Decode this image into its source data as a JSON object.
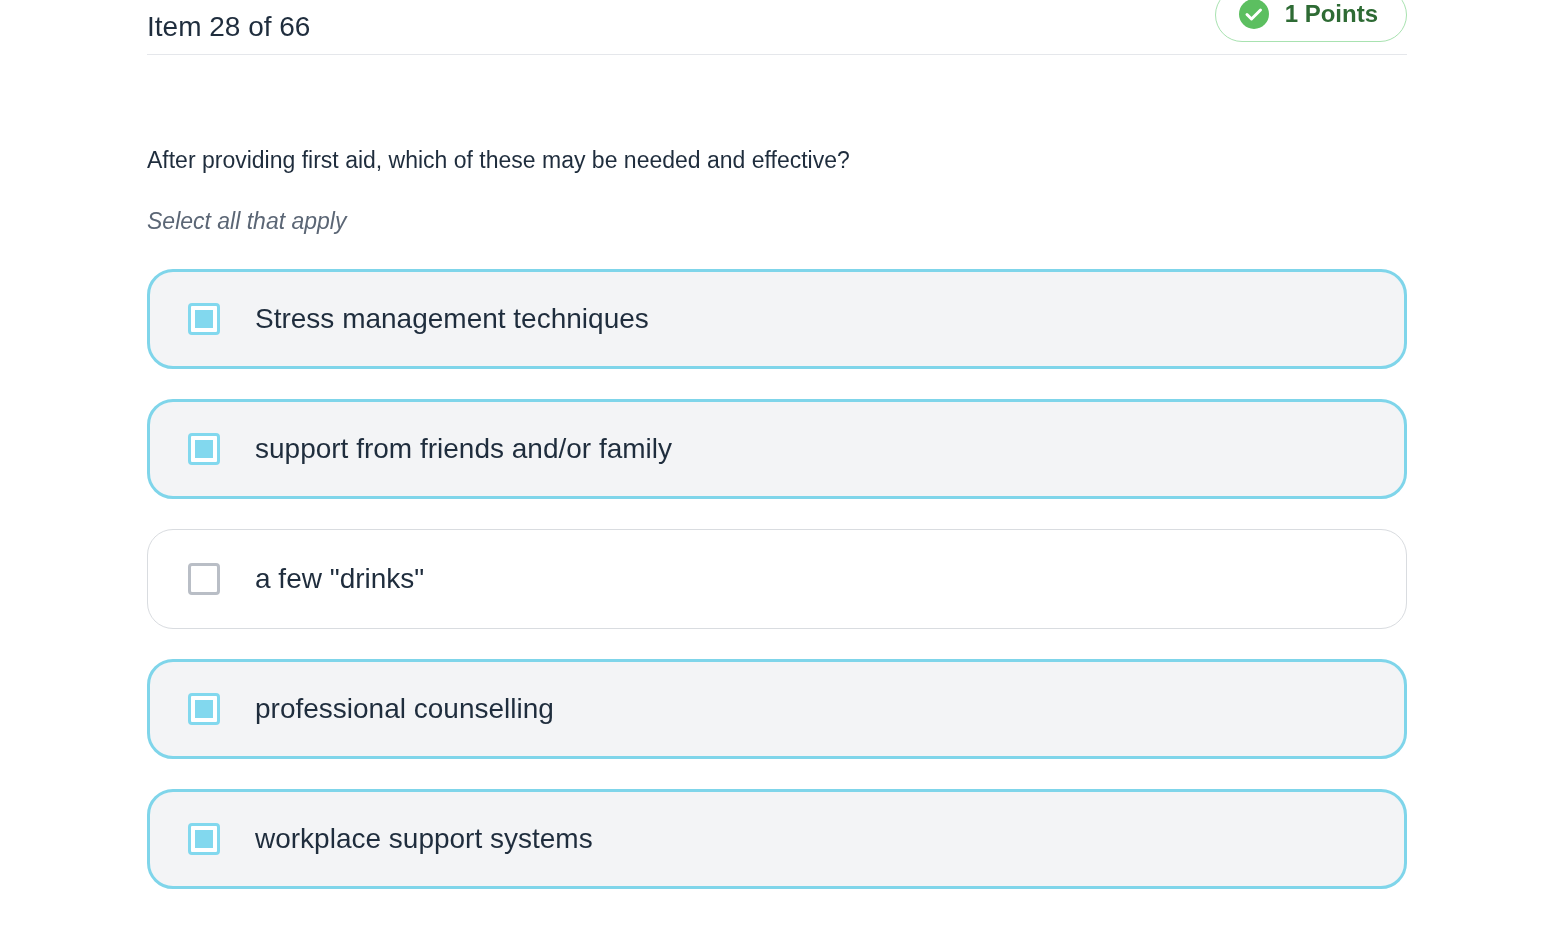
{
  "header": {
    "item_counter": "Item 28 of 66",
    "points": "1 Points"
  },
  "question": "After providing first aid, which of these may be needed and effective?",
  "instruction": "Select all that apply",
  "options": [
    {
      "label": "Stress management techniques",
      "checked": true
    },
    {
      "label": "support from friends and/or family",
      "checked": true
    },
    {
      "label": "a few \"drinks\"",
      "checked": false
    },
    {
      "label": "professional counselling",
      "checked": true
    },
    {
      "label": "workplace support systems",
      "checked": true
    }
  ]
}
